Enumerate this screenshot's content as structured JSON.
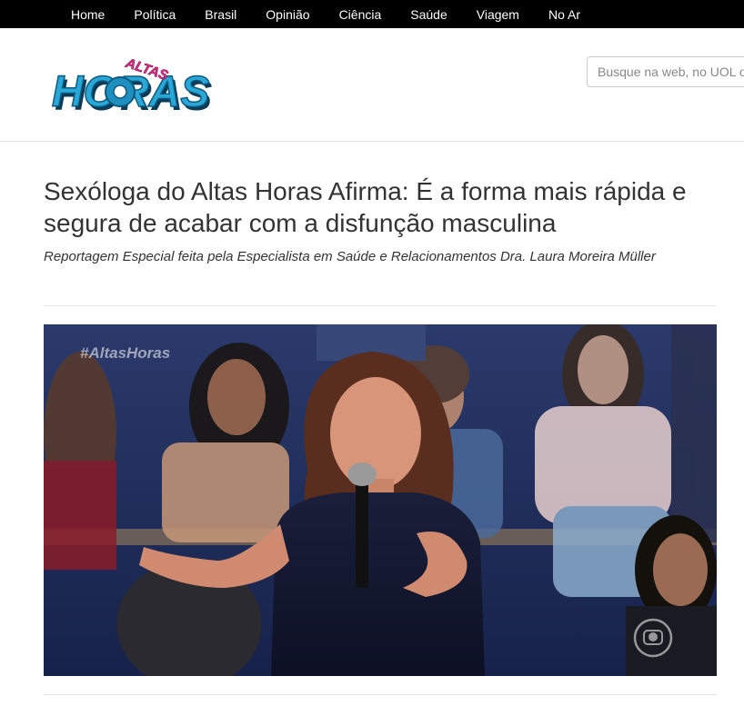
{
  "nav": {
    "items": [
      "Home",
      "Política",
      "Brasil",
      "Opinião",
      "Ciência",
      "Saúde",
      "Viagem",
      "No Ar"
    ]
  },
  "header": {
    "logo": {
      "text_top": "ALTAS",
      "text_main": "HORAS"
    },
    "search_placeholder": "Busque na web, no UOL o"
  },
  "article": {
    "title": "Sexóloga do Altas Horas Afirma: É a forma mais rápida e segura de acabar com a disfunção masculina",
    "subtitle": "Reportagem Especial feita pela Especialista em Saúde e Relacionamentos Dra. Laura Moreira Müller",
    "image": {
      "watermark": "#AltasHoras",
      "description_icon": "tv-globo-logo"
    }
  },
  "colors": {
    "nav_bg": "#000000",
    "logo_blue": "#29a8d8",
    "logo_pink": "#e8308c"
  }
}
